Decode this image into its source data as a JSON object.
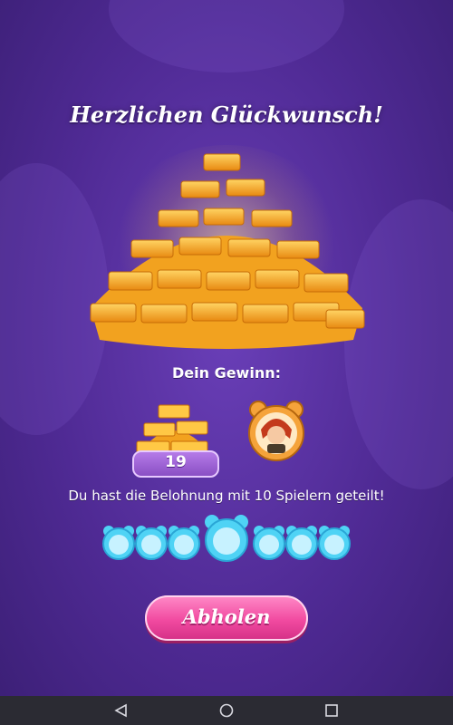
{
  "dialog": {
    "title": "Herzlichen Glückwunsch!",
    "win_label": "Dein Gewinn:",
    "reward_count": "19",
    "shared_text": "Du hast die Belohnung mit 10 Spielern geteilt!",
    "claim_button": "Abholen"
  },
  "icons": {
    "main_reward": "gold-bars-pile",
    "small_reward": "gold-bars",
    "booster": "character-portrait",
    "players": "teddy-avatar",
    "nav": [
      "back-triangle",
      "home-circle",
      "recents-square"
    ]
  },
  "colors": {
    "background": "#4f2a94",
    "button": "#f14aa0",
    "player_frame": "#4fd3f5",
    "gold": "#f7a824"
  }
}
